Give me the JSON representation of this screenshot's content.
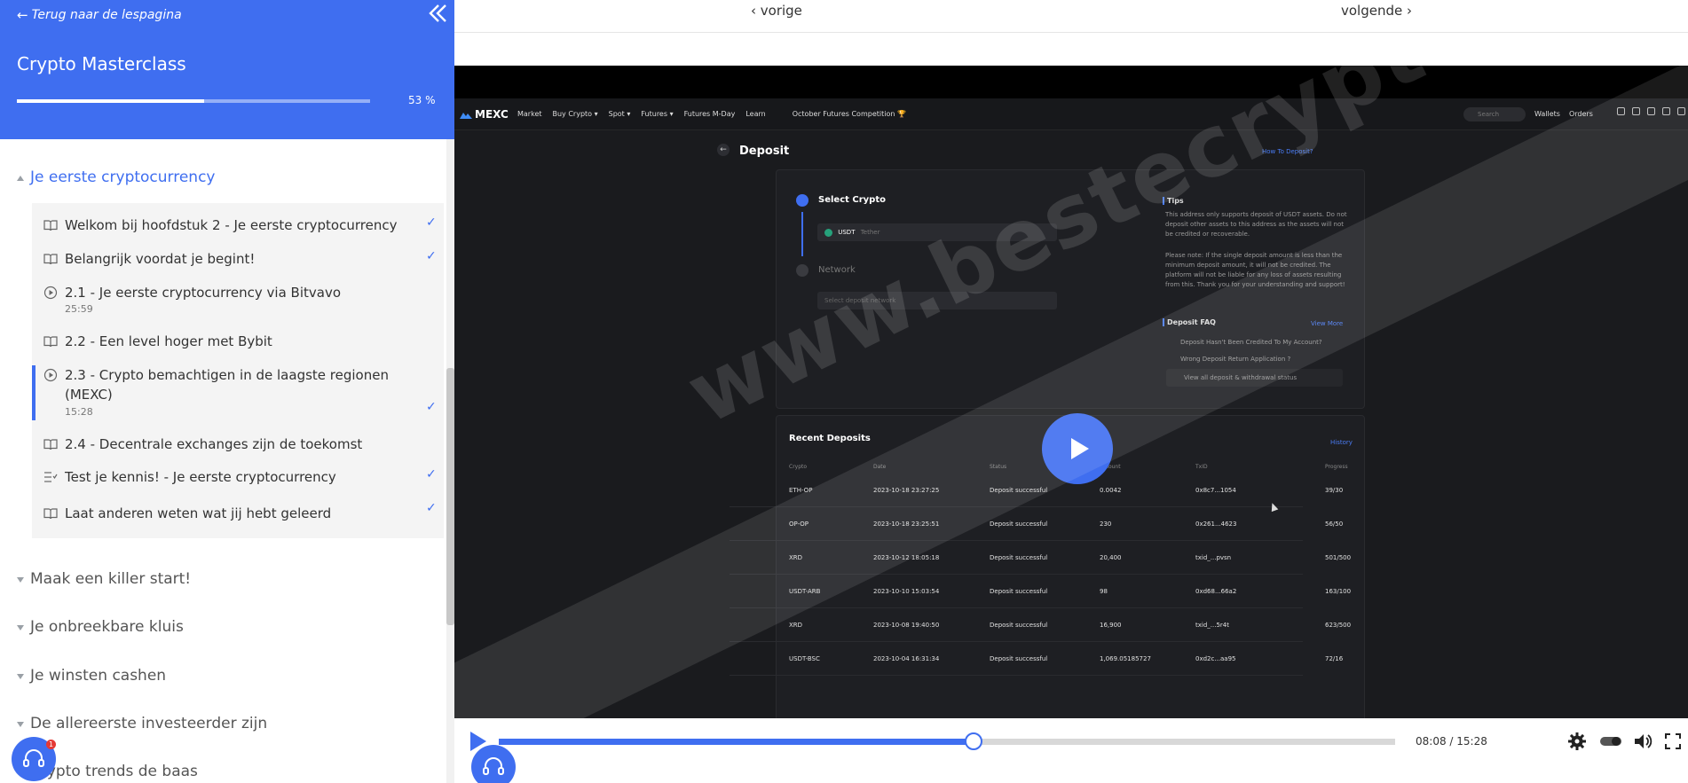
{
  "sidebar": {
    "back_label": "Terug naar de lespagina",
    "course_title": "Crypto Masterclass",
    "progress_percent": 53,
    "progress_label": "53 %",
    "chapters": [
      {
        "label": "Je eerste cryptocurrency",
        "expanded": true
      },
      {
        "label": "Maak een killer start!",
        "expanded": false
      },
      {
        "label": "Je onbreekbare kluis",
        "expanded": false
      },
      {
        "label": "Je winsten cashen",
        "expanded": false
      },
      {
        "label": "De allereerste investeerder zijn",
        "expanded": false
      },
      {
        "label": "Crypto trends de baas",
        "expanded": false
      }
    ],
    "lessons": [
      {
        "label": "Welkom bij hoofdstuk 2 - Je eerste cryptocurrency",
        "icon": "book-icon",
        "duration": "",
        "done": true
      },
      {
        "label": "Belangrijk voordat je begint!",
        "icon": "book-icon",
        "duration": "",
        "done": true
      },
      {
        "label": "2.1 - Je eerste cryptocurrency via Bitvavo",
        "icon": "play-circle-icon",
        "duration": "25:59",
        "done": false
      },
      {
        "label": "2.2 - Een level hoger met Bybit",
        "icon": "book-icon",
        "duration": "",
        "done": false
      },
      {
        "label": "2.3 - Crypto bemachtigen in de laagste regionen (MEXC)",
        "icon": "play-circle-icon",
        "duration": "15:28",
        "done": true,
        "current": true
      },
      {
        "label": "2.4 - Decentrale exchanges zijn de toekomst",
        "icon": "book-icon",
        "duration": "",
        "done": false
      },
      {
        "label": "Test je kennis! - Je eerste cryptocurrency",
        "icon": "quiz-icon",
        "duration": "",
        "done": true
      },
      {
        "label": "Laat anderen weten wat jij hebt geleerd",
        "icon": "book-icon",
        "duration": "",
        "done": true
      }
    ],
    "check_glyph": "✓",
    "support_count": "1"
  },
  "nav": {
    "prev_label": "‹ vorige",
    "next_label": "volgende ›"
  },
  "video": {
    "watermark": "www.bestecryptobroker.nl",
    "current_time": "08:08",
    "duration": "15:28",
    "time_label": "08:08 / 15:28",
    "played_fraction": 0.53,
    "screen": {
      "logo": "MEXC",
      "menu": [
        "Market",
        "Buy Crypto ▾",
        "Spot ▾",
        "Futures ▾",
        "Futures M-Day",
        "Learn",
        "October Futures Competition 🏆"
      ],
      "search_placeholder": "Search",
      "right_menu": [
        "Wallets",
        "Orders"
      ],
      "page_title": "Deposit",
      "how_to": "How To Deposit?",
      "step1": "Select Crypto",
      "coin": "USDT",
      "coin_sub": "Tether",
      "step2": "Network",
      "network_placeholder": "Select deposit network",
      "tips_title": "Tips",
      "tips_1": "This address only supports deposit of USDT assets. Do not deposit other assets to this address as the assets will not be credited or recoverable.",
      "tips_2": "Please note: If the single deposit amount is less than the minimum deposit amount, it will not be credited. The platform will not be liable for any loss of assets resulting from this. Thank you for your understanding and support!",
      "faq_title": "Deposit FAQ",
      "view_more": "View More",
      "faq_items": [
        "Deposit Hasn't Been Credited To My Account?",
        "Wrong Deposit Return Application ?",
        "View all deposit & withdrawal status"
      ],
      "recent_title": "Recent Deposits",
      "history": "History",
      "columns": [
        "Crypto",
        "Date",
        "Status",
        "Amount",
        "TxID",
        "Progress"
      ],
      "rows": [
        [
          "ETH-OP",
          "2023-10-18 23:27:25",
          "Deposit successful",
          "0.0042",
          "0x8c7...1054",
          "39/30"
        ],
        [
          "OP-OP",
          "2023-10-18 23:25:51",
          "Deposit successful",
          "230",
          "0x261...4623",
          "56/50"
        ],
        [
          "XRD",
          "2023-10-12 18:05:18",
          "Deposit successful",
          "20,400",
          "txid_...pvsn",
          "501/500"
        ],
        [
          "USDT-ARB",
          "2023-10-10 15:03:54",
          "Deposit successful",
          "98",
          "0xd68...66a2",
          "163/100"
        ],
        [
          "XRD",
          "2023-10-08 19:40:50",
          "Deposit successful",
          "16,900",
          "txid_...5r4t",
          "623/500"
        ],
        [
          "USDT-BSC",
          "2023-10-04 16:31:34",
          "Deposit successful",
          "1,069.05185727",
          "0xd2c...aa95",
          "72/16"
        ]
      ]
    }
  },
  "colors": {
    "accent": "#3f6ef0",
    "sidebar_bg": "#ffffff",
    "lessons_bg": "#f4f4f4",
    "video_bg": "#1a1b1e"
  }
}
